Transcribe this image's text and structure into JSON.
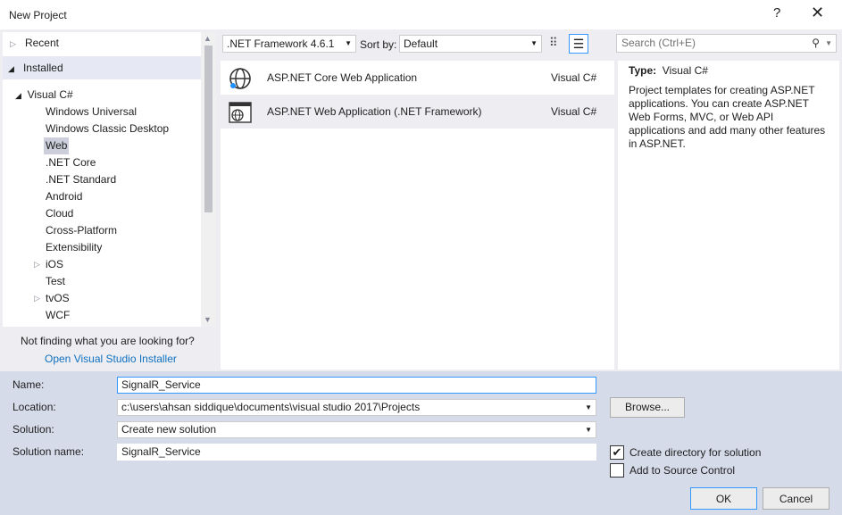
{
  "window": {
    "title": "New Project",
    "help": "?",
    "close": "✕"
  },
  "tree": {
    "recent": "Recent",
    "installed": "Installed",
    "visual_csharp": "Visual C#",
    "items": [
      "Windows Universal",
      "Windows Classic Desktop",
      "Web",
      ".NET Core",
      ".NET Standard",
      "Android",
      "Cloud",
      "Cross-Platform",
      "Extensibility",
      "iOS",
      "Test",
      "tvOS",
      "WCF"
    ],
    "selected": "Web"
  },
  "not_finding": {
    "text": "Not finding what you are looking for?",
    "link": "Open Visual Studio Installer"
  },
  "toolbar": {
    "framework": ".NET Framework 4.6.1",
    "sort_label": "Sort by:",
    "sort_value": "Default",
    "search_placeholder": "Search (Ctrl+E)"
  },
  "templates": [
    {
      "name": "ASP.NET Core Web Application",
      "lang": "Visual C#"
    },
    {
      "name": "ASP.NET Web Application (.NET Framework)",
      "lang": "Visual C#",
      "selected": true
    }
  ],
  "description": {
    "type_label": "Type:",
    "type_value": "Visual C#",
    "text": "Project templates for creating ASP.NET applications. You can create ASP.NET Web Forms, MVC, or Web API applications and add many other features in ASP.NET."
  },
  "form": {
    "name_label": "Name:",
    "name_value": "SignalR_Service",
    "location_label": "Location:",
    "location_value": "c:\\users\\ahsan siddique\\documents\\visual studio 2017\\Projects",
    "solution_label": "Solution:",
    "solution_value": "Create new solution",
    "solution_name_label": "Solution name:",
    "solution_name_value": "SignalR_Service",
    "browse": "Browse...",
    "create_dir": "Create directory for solution",
    "create_dir_checked": true,
    "add_source": "Add to Source Control",
    "add_source_checked": false,
    "ok": "OK",
    "cancel": "Cancel"
  }
}
